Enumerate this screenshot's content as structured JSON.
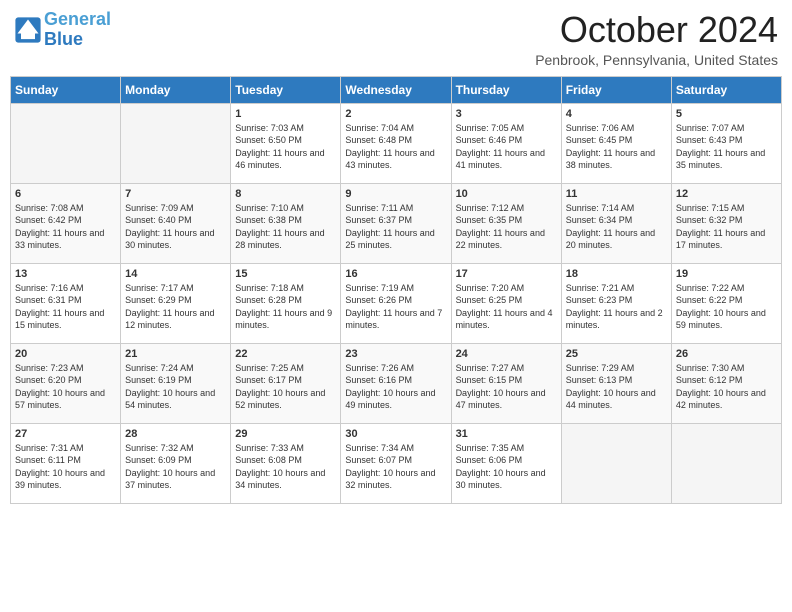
{
  "header": {
    "logo_line1": "General",
    "logo_line2": "Blue",
    "month_year": "October 2024",
    "location": "Penbrook, Pennsylvania, United States"
  },
  "days_of_week": [
    "Sunday",
    "Monday",
    "Tuesday",
    "Wednesday",
    "Thursday",
    "Friday",
    "Saturday"
  ],
  "weeks": [
    [
      {
        "num": "",
        "info": ""
      },
      {
        "num": "",
        "info": ""
      },
      {
        "num": "1",
        "info": "Sunrise: 7:03 AM\nSunset: 6:50 PM\nDaylight: 11 hours and 46 minutes."
      },
      {
        "num": "2",
        "info": "Sunrise: 7:04 AM\nSunset: 6:48 PM\nDaylight: 11 hours and 43 minutes."
      },
      {
        "num": "3",
        "info": "Sunrise: 7:05 AM\nSunset: 6:46 PM\nDaylight: 11 hours and 41 minutes."
      },
      {
        "num": "4",
        "info": "Sunrise: 7:06 AM\nSunset: 6:45 PM\nDaylight: 11 hours and 38 minutes."
      },
      {
        "num": "5",
        "info": "Sunrise: 7:07 AM\nSunset: 6:43 PM\nDaylight: 11 hours and 35 minutes."
      }
    ],
    [
      {
        "num": "6",
        "info": "Sunrise: 7:08 AM\nSunset: 6:42 PM\nDaylight: 11 hours and 33 minutes."
      },
      {
        "num": "7",
        "info": "Sunrise: 7:09 AM\nSunset: 6:40 PM\nDaylight: 11 hours and 30 minutes."
      },
      {
        "num": "8",
        "info": "Sunrise: 7:10 AM\nSunset: 6:38 PM\nDaylight: 11 hours and 28 minutes."
      },
      {
        "num": "9",
        "info": "Sunrise: 7:11 AM\nSunset: 6:37 PM\nDaylight: 11 hours and 25 minutes."
      },
      {
        "num": "10",
        "info": "Sunrise: 7:12 AM\nSunset: 6:35 PM\nDaylight: 11 hours and 22 minutes."
      },
      {
        "num": "11",
        "info": "Sunrise: 7:14 AM\nSunset: 6:34 PM\nDaylight: 11 hours and 20 minutes."
      },
      {
        "num": "12",
        "info": "Sunrise: 7:15 AM\nSunset: 6:32 PM\nDaylight: 11 hours and 17 minutes."
      }
    ],
    [
      {
        "num": "13",
        "info": "Sunrise: 7:16 AM\nSunset: 6:31 PM\nDaylight: 11 hours and 15 minutes."
      },
      {
        "num": "14",
        "info": "Sunrise: 7:17 AM\nSunset: 6:29 PM\nDaylight: 11 hours and 12 minutes."
      },
      {
        "num": "15",
        "info": "Sunrise: 7:18 AM\nSunset: 6:28 PM\nDaylight: 11 hours and 9 minutes."
      },
      {
        "num": "16",
        "info": "Sunrise: 7:19 AM\nSunset: 6:26 PM\nDaylight: 11 hours and 7 minutes."
      },
      {
        "num": "17",
        "info": "Sunrise: 7:20 AM\nSunset: 6:25 PM\nDaylight: 11 hours and 4 minutes."
      },
      {
        "num": "18",
        "info": "Sunrise: 7:21 AM\nSunset: 6:23 PM\nDaylight: 11 hours and 2 minutes."
      },
      {
        "num": "19",
        "info": "Sunrise: 7:22 AM\nSunset: 6:22 PM\nDaylight: 10 hours and 59 minutes."
      }
    ],
    [
      {
        "num": "20",
        "info": "Sunrise: 7:23 AM\nSunset: 6:20 PM\nDaylight: 10 hours and 57 minutes."
      },
      {
        "num": "21",
        "info": "Sunrise: 7:24 AM\nSunset: 6:19 PM\nDaylight: 10 hours and 54 minutes."
      },
      {
        "num": "22",
        "info": "Sunrise: 7:25 AM\nSunset: 6:17 PM\nDaylight: 10 hours and 52 minutes."
      },
      {
        "num": "23",
        "info": "Sunrise: 7:26 AM\nSunset: 6:16 PM\nDaylight: 10 hours and 49 minutes."
      },
      {
        "num": "24",
        "info": "Sunrise: 7:27 AM\nSunset: 6:15 PM\nDaylight: 10 hours and 47 minutes."
      },
      {
        "num": "25",
        "info": "Sunrise: 7:29 AM\nSunset: 6:13 PM\nDaylight: 10 hours and 44 minutes."
      },
      {
        "num": "26",
        "info": "Sunrise: 7:30 AM\nSunset: 6:12 PM\nDaylight: 10 hours and 42 minutes."
      }
    ],
    [
      {
        "num": "27",
        "info": "Sunrise: 7:31 AM\nSunset: 6:11 PM\nDaylight: 10 hours and 39 minutes."
      },
      {
        "num": "28",
        "info": "Sunrise: 7:32 AM\nSunset: 6:09 PM\nDaylight: 10 hours and 37 minutes."
      },
      {
        "num": "29",
        "info": "Sunrise: 7:33 AM\nSunset: 6:08 PM\nDaylight: 10 hours and 34 minutes."
      },
      {
        "num": "30",
        "info": "Sunrise: 7:34 AM\nSunset: 6:07 PM\nDaylight: 10 hours and 32 minutes."
      },
      {
        "num": "31",
        "info": "Sunrise: 7:35 AM\nSunset: 6:06 PM\nDaylight: 10 hours and 30 minutes."
      },
      {
        "num": "",
        "info": ""
      },
      {
        "num": "",
        "info": ""
      }
    ]
  ]
}
